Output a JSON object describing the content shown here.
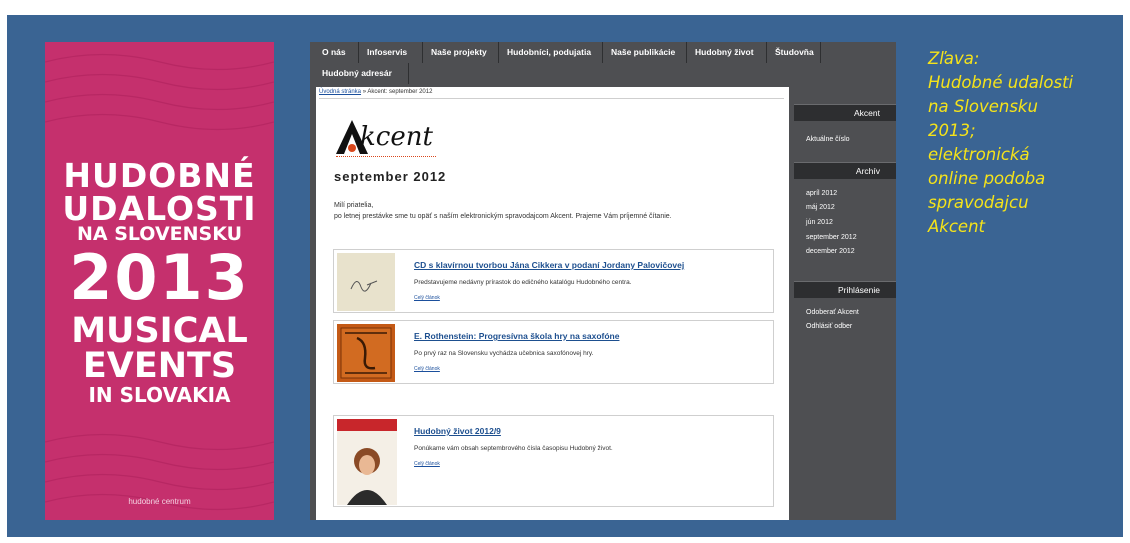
{
  "poster": {
    "lines": [
      "HUDOBNÉ",
      "UDALOSTI",
      "NA SLOVENSKU",
      "2013",
      "MUSICAL",
      "EVENTS",
      "IN SLOVAKIA"
    ],
    "logo_text": "hudobné centrum"
  },
  "site": {
    "nav": [
      "O nás",
      "Infoservis",
      "Naše projekty",
      "Hudobníci, podujatia",
      "Naše publikácie",
      "Hudobný život",
      "Študovňa",
      "Hudobný adresár"
    ],
    "breadcrumb": {
      "home": "Úvodná stránka",
      "separator": " » ",
      "current": "Akcent: september 2012"
    },
    "logo_word": "kcent",
    "issue_title": "september 2012",
    "greeting_line1": "Milí priatelia,",
    "greeting_line2": "po letnej prestávke sme tu opäť s naším elektronickým spravodajcom Akcent. Prajeme Vám príjemné čítanie.",
    "articles": [
      {
        "title": "CD s klavírnou tvorbou Jána Cikkera v podaní Jordany Palovičovej",
        "desc": "Predstavujeme nedávny prírastok do edičného katalógu Hudobného centra.",
        "link": "Celý článok"
      },
      {
        "title": "E. Rothenstein: Progresívna škola hry na saxofóne",
        "desc": "Po prvý raz na Slovensku vychádza učebnica saxofónovej hry.",
        "link": "Celý článok"
      },
      {
        "title": "Hudobný život 2012/9",
        "desc": "Ponúkame vám obsah septembrového čísla časopisu Hudobný život.",
        "link": "Celý článok"
      }
    ],
    "sidebar": {
      "akcent_head": "Akcent",
      "akcent_links": [
        "Aktuálne číslo"
      ],
      "archiv_head": "Archív",
      "archiv_links": [
        "apríl 2012",
        "máj 2012",
        "jún 2012",
        "september 2012",
        "december 2012"
      ],
      "login_head": "Prihlásenie",
      "login_links": [
        "Odoberať Akcent",
        "Odhlásiť odber"
      ]
    }
  },
  "caption": [
    "Zľava:",
    "Hudobné udalosti",
    "na Slovensku",
    "2013;",
    "elektronická",
    "online podoba",
    "spravodajcu",
    "Akcent"
  ],
  "colors": {
    "slide_bg": "#3a6493",
    "poster_bg": "#c5306d",
    "caption": "#f5e31a",
    "site_dark": "#4e4f52"
  }
}
